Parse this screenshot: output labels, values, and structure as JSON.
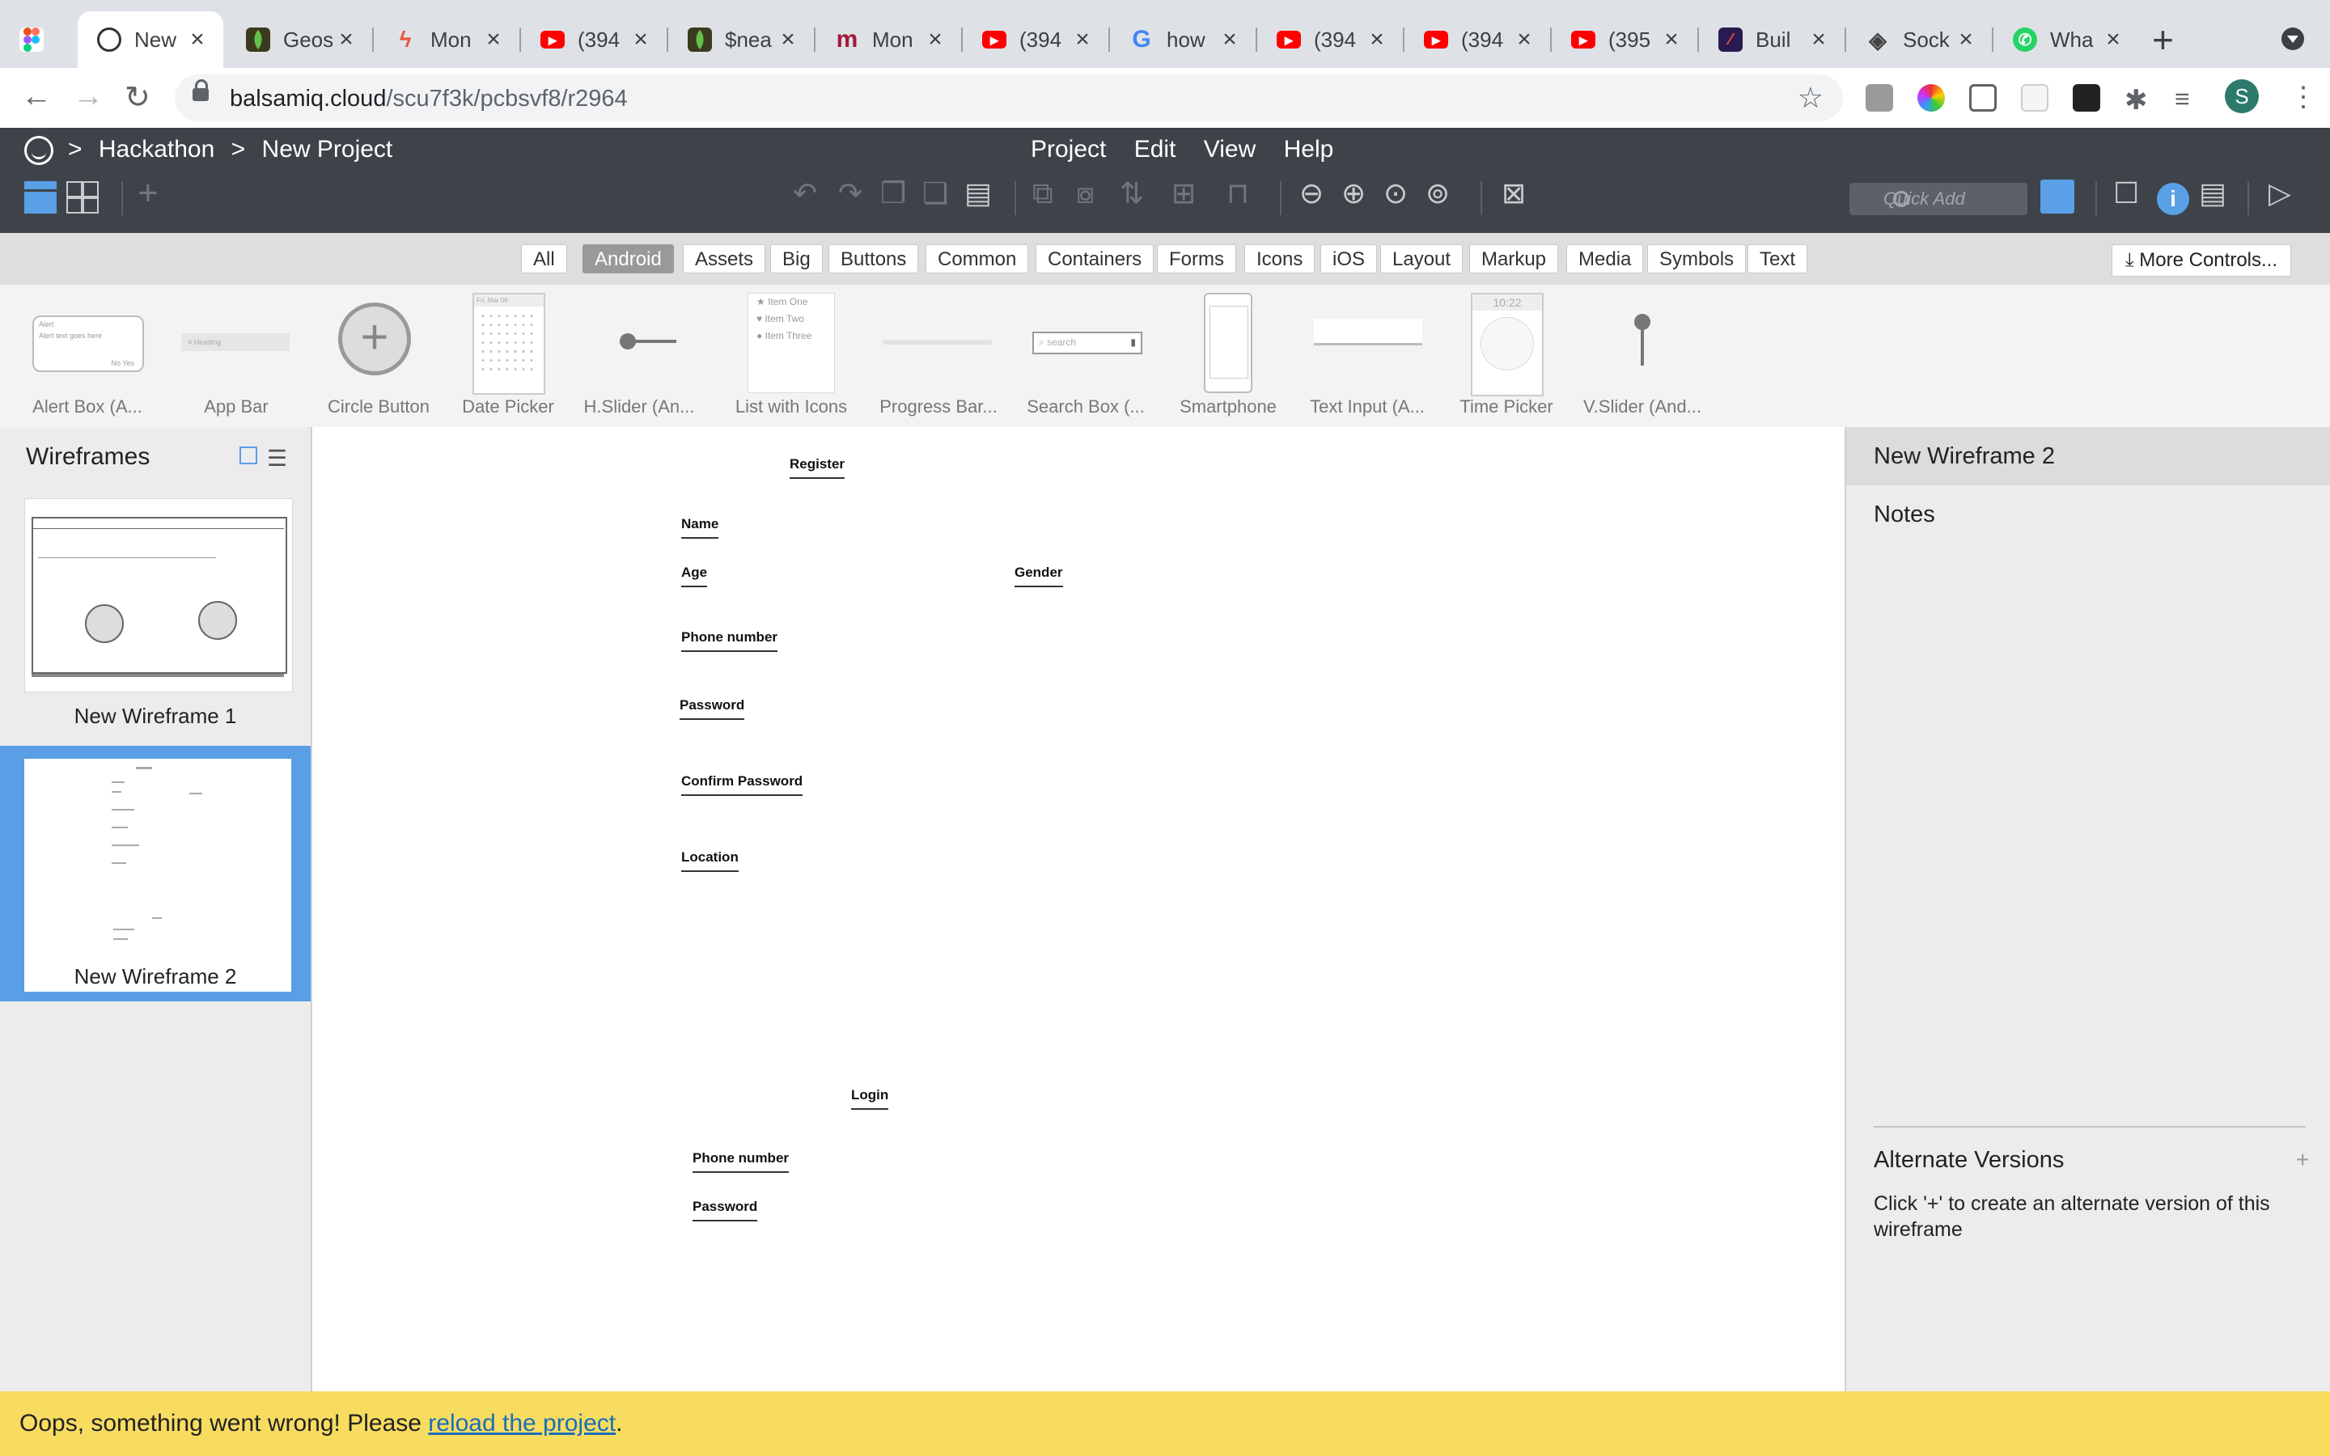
{
  "browser": {
    "tabs": [
      {
        "title": "",
        "favicon": "figma-icon",
        "color": "#f24e1e"
      },
      {
        "title": "New",
        "favicon": "balsamiq-icon",
        "color": "#333333",
        "active": true
      },
      {
        "title": "Geos",
        "favicon": "mongodb-icon",
        "color": "#3c3a1e"
      },
      {
        "title": "Mon",
        "favicon": "bolt-icon",
        "color": "#e8563b"
      },
      {
        "title": "(394",
        "favicon": "youtube-icon",
        "color": "#ff0000"
      },
      {
        "title": "$nea",
        "favicon": "mongodb-icon",
        "color": "#3c3a1e"
      },
      {
        "title": "Mon",
        "favicon": "m-icon",
        "color": "#a3183b"
      },
      {
        "title": "(394",
        "favicon": "youtube-icon",
        "color": "#ff0000"
      },
      {
        "title": "how",
        "favicon": "google-icon",
        "color": "#4285f4"
      },
      {
        "title": "(394",
        "favicon": "youtube-icon",
        "color": "#ff0000"
      },
      {
        "title": "(394",
        "favicon": "youtube-icon",
        "color": "#ff0000"
      },
      {
        "title": "(395",
        "favicon": "youtube-icon",
        "color": "#ff0000"
      },
      {
        "title": "Buil",
        "favicon": "feather-icon",
        "color": "#2a1a52"
      },
      {
        "title": "Sock",
        "favicon": "socket-icon",
        "color": "#444444"
      },
      {
        "title": "Wha",
        "favicon": "whatsapp-icon",
        "color": "#25d366"
      }
    ],
    "url_host": "balsamiq.cloud",
    "url_path": "/scu7f3k/pcbsvf8/r2964",
    "profile_initial": "S"
  },
  "app": {
    "breadcrumb": {
      "sep": ">",
      "project_group": "Hackathon",
      "project": "New Project"
    },
    "menu": [
      "Project",
      "Edit",
      "View",
      "Help"
    ],
    "quick_add_placeholder": "Quick Add",
    "info_glyph": "i"
  },
  "library": {
    "filters": [
      "All",
      "Android",
      "Assets",
      "Big",
      "Buttons",
      "Common",
      "Containers",
      "Forms",
      "Icons",
      "iOS",
      "Layout",
      "Markup",
      "Media",
      "Symbols",
      "Text"
    ],
    "selected_filter": "Android",
    "more_controls": "More Controls...",
    "components": [
      {
        "label": "Alert Box (A...",
        "inner_title": "Alert",
        "inner_text": "Alert text goes here",
        "inner_btns": "No  Yes"
      },
      {
        "label": "App Bar",
        "inner_text": "Heading"
      },
      {
        "label": "Circle Button"
      },
      {
        "label": "Date Picker",
        "inner_text": "Fri, Mar 06"
      },
      {
        "label": "H.Slider (An..."
      },
      {
        "label": "List with Icons",
        "items": [
          "Item One",
          "Item Two",
          "Item Three"
        ]
      },
      {
        "label": "Progress Bar..."
      },
      {
        "label": "Search Box (...",
        "inner_text": "search"
      },
      {
        "label": "Smartphone"
      },
      {
        "label": "Text Input (A..."
      },
      {
        "label": "Time Picker",
        "inner_text": "10:22"
      },
      {
        "label": "V.Slider (And..."
      }
    ]
  },
  "wireframes": {
    "title": "Wireframes",
    "items": [
      {
        "label": "New Wireframe 1",
        "selected": false
      },
      {
        "label": "New Wireframe 2",
        "selected": true
      }
    ]
  },
  "canvas": {
    "register_labels": [
      "Register",
      "Name",
      "Age",
      "Gender",
      "Phone number",
      "Password",
      "Confirm Password",
      "Location"
    ],
    "login_labels": [
      "Login",
      "Phone number",
      "Password"
    ]
  },
  "inspector": {
    "title": "New Wireframe 2",
    "notes": "Notes",
    "alt_versions": "Alternate Versions",
    "alt_plus": "+",
    "alt_help": "Click '+' to create an alternate version of this wireframe"
  },
  "error": {
    "prefix": "Oops, something went wrong! Please ",
    "link": "reload the project",
    "suffix": "."
  },
  "colors": {
    "accent": "#5aa0e6",
    "header": "#3d4349",
    "error_bar": "#f7dc60"
  }
}
